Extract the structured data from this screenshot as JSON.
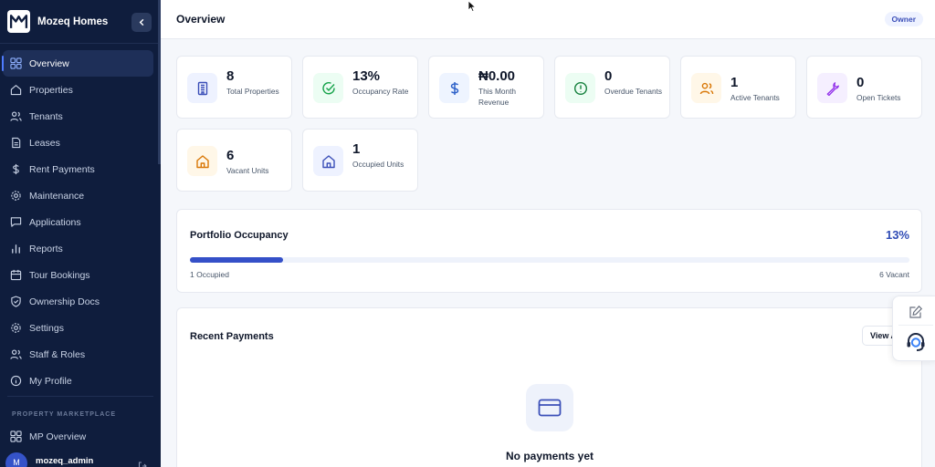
{
  "app": {
    "brand": "Mozeq Homes",
    "page_title": "Overview",
    "role": "Owner"
  },
  "sidebar": {
    "items": [
      {
        "label": "Overview",
        "icon": "grid-icon",
        "active": true
      },
      {
        "label": "Properties",
        "icon": "home-icon"
      },
      {
        "label": "Tenants",
        "icon": "users-icon"
      },
      {
        "label": "Leases",
        "icon": "document-icon"
      },
      {
        "label": "Rent Payments",
        "icon": "dollar-icon"
      },
      {
        "label": "Maintenance",
        "icon": "gear-icon"
      },
      {
        "label": "Applications",
        "icon": "message-icon"
      },
      {
        "label": "Reports",
        "icon": "bar-chart-icon"
      },
      {
        "label": "Tour Bookings",
        "icon": "calendar-icon"
      },
      {
        "label": "Ownership Docs",
        "icon": "shield-icon"
      },
      {
        "label": "Settings",
        "icon": "settings-icon"
      },
      {
        "label": "Staff & Roles",
        "icon": "users-icon"
      },
      {
        "label": "My Profile",
        "icon": "info-icon"
      }
    ],
    "section_label": "PROPERTY MARKETPLACE",
    "mp_item": "MP Overview",
    "user": {
      "initial": "M",
      "name": "mozeq_admin"
    }
  },
  "stats": [
    {
      "value": "8",
      "label": "Total Properties",
      "icon": "building-icon",
      "accent": "#3b4fb8",
      "bg": "#eef2ff"
    },
    {
      "value": "13%",
      "label": "Occupancy Rate",
      "icon": "check-circle-icon",
      "accent": "#16a34a",
      "bg": "#ecfdf3"
    },
    {
      "value": "₦0.00",
      "label": "This Month Revenue",
      "icon": "dollar-icon",
      "accent": "#2f62c9",
      "bg": "#eef4ff"
    },
    {
      "value": "0",
      "label": "Overdue Tenants",
      "icon": "alert-circle-icon",
      "accent": "#15803d",
      "bg": "#ecfdf3"
    },
    {
      "value": "1",
      "label": "Active Tenants",
      "icon": "users-icon",
      "accent": "#d97706",
      "bg": "#fff7e8"
    },
    {
      "value": "0",
      "label": "Open Tickets",
      "icon": "wrench-icon",
      "accent": "#9333ea",
      "bg": "#f5efff"
    },
    {
      "value": "6",
      "label": "Vacant Units",
      "icon": "home-icon",
      "accent": "#d97706",
      "bg": "#fff7e8"
    },
    {
      "value": "1",
      "label": "Occupied Units",
      "icon": "home-icon",
      "accent": "#3b4fb8",
      "bg": "#eef2ff"
    }
  ],
  "occupancy": {
    "title": "Portfolio Occupancy",
    "percent_label": "13%",
    "fraction": 0.13,
    "occupied_label": "1 Occupied",
    "vacant_label": "6 Vacant"
  },
  "payments": {
    "title": "Recent Payments",
    "view_all": "View All",
    "empty_text": "No payments yet"
  }
}
